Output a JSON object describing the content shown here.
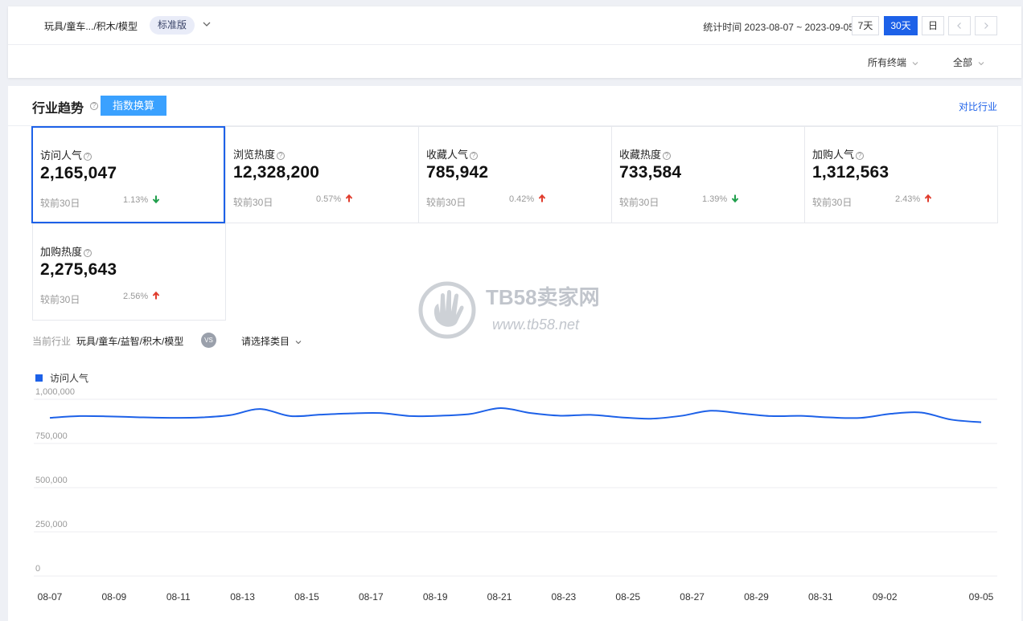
{
  "topbar": {
    "category": "玩具/童车.../积木/模型",
    "edition": "标准版",
    "stat_label": "统计时间 2023-08-07 ~ 2023-09-05",
    "range_buttons": [
      {
        "label": "7天"
      },
      {
        "label": "30天"
      },
      {
        "label": "日"
      }
    ],
    "terminal": "所有终端",
    "scope": "全部"
  },
  "section": {
    "title": "行业趋势",
    "index_button": "指数换算",
    "compare_link": "对比行业"
  },
  "cards": [
    {
      "label": "访问人气",
      "value": "2,165,047",
      "compare": "较前30日",
      "pct": "1.13%",
      "trend": "down"
    },
    {
      "label": "浏览热度",
      "value": "12,328,200",
      "compare": "较前30日",
      "pct": "0.57%",
      "trend": "up"
    },
    {
      "label": "收藏人气",
      "value": "785,942",
      "compare": "较前30日",
      "pct": "0.42%",
      "trend": "up"
    },
    {
      "label": "收藏热度",
      "value": "733,584",
      "compare": "较前30日",
      "pct": "1.39%",
      "trend": "down"
    },
    {
      "label": "加购人气",
      "value": "1,312,563",
      "compare": "较前30日",
      "pct": "2.43%",
      "trend": "up"
    },
    {
      "label": "加购热度",
      "value": "2,275,643",
      "compare": "较前30日",
      "pct": "2.56%",
      "trend": "up"
    }
  ],
  "filter": {
    "label": "当前行业",
    "industry": "玩具/童车/益智/积木/模型",
    "vs": "VS",
    "select": "请选择类目"
  },
  "watermark": {
    "brand": "TB58卖家网",
    "url": "www.tb58.net"
  },
  "colors": {
    "accent": "#1d61e8",
    "up": "#e03b2c",
    "down": "#1f9e4b",
    "index_btn": "#3aa1ff"
  },
  "chart_data": {
    "type": "line",
    "legend": "访问人气",
    "ylim": [
      0,
      1000000
    ],
    "yticks": [
      "1,000,000",
      "750,000",
      "500,000",
      "250,000",
      "0"
    ],
    "ytick_values": [
      1000000,
      750000,
      500000,
      250000,
      0
    ],
    "xtick_labels": [
      "08-07",
      "08-09",
      "08-11",
      "08-13",
      "08-15",
      "08-17",
      "08-19",
      "08-21",
      "08-23",
      "08-25",
      "08-27",
      "08-29",
      "08-31",
      "09-02",
      "09-05"
    ],
    "xtick_index": [
      0,
      2,
      4,
      6,
      8,
      10,
      12,
      14,
      16,
      18,
      20,
      22,
      24,
      26,
      29
    ],
    "series": [
      {
        "name": "访问人气",
        "values": [
          895000,
          905000,
          903000,
          898000,
          895000,
          897000,
          910000,
          945000,
          905000,
          913000,
          920000,
          922000,
          905000,
          907000,
          917000,
          950000,
          922000,
          907000,
          912000,
          898000,
          890000,
          906000,
          935000,
          920000,
          905000,
          906000,
          897000,
          895000,
          918000,
          925000,
          885000,
          870000
        ]
      }
    ]
  }
}
